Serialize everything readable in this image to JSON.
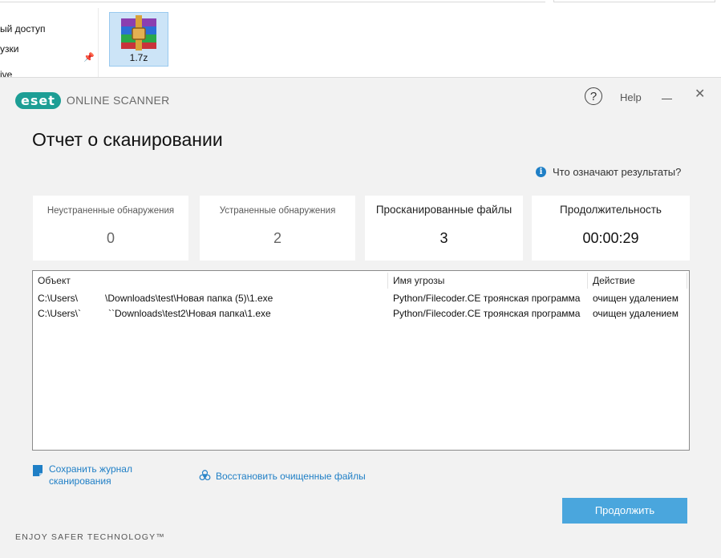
{
  "explorer": {
    "nav_items": [
      "ый доступ",
      "узки",
      "ive"
    ],
    "file": {
      "name": "1.7z",
      "icon": "winrar-archive-icon"
    }
  },
  "dialog": {
    "brand_logo": "eset",
    "product": "ONLINE SCANNER",
    "help_symbol": "?",
    "help_label": "Help",
    "close_symbol": "✕",
    "title": "Отчет о сканировании",
    "results_help": "Что означают результаты?",
    "stats": [
      {
        "label": "Неустраненные обнаружения",
        "value": "0"
      },
      {
        "label": "Устраненные обнаружения",
        "value": "2"
      },
      {
        "label": "Просканированные файлы",
        "value": "3"
      },
      {
        "label": "Продолжительность",
        "value": "00:00:29"
      }
    ],
    "table": {
      "headers": [
        "Объект",
        "Имя угрозы",
        "Действие"
      ],
      "rows": [
        {
          "object_start": "C:\\Users\\",
          "object_end": "\\Downloads\\test\\Новая папка (5)\\1.exe",
          "threat": "Python/Filecoder.CE троянская программа",
          "action": "очищен удалением"
        },
        {
          "object_start": "C:\\Users\\`",
          "object_end": "``Downloads\\test2\\Новая папка\\1.exe",
          "threat": "Python/Filecoder.CE троянская программа",
          "action": "очищен удалением"
        }
      ]
    },
    "save_log": "Сохранить журнал сканирования",
    "restore": "Восстановить очищенные файлы",
    "continue": "Продолжить",
    "tagline": "ENJOY SAFER TECHNOLOGY™"
  },
  "colors": {
    "eset_teal": "#1d9e95",
    "link_blue": "#1f7fc6",
    "button_blue": "#4aa6dd"
  }
}
